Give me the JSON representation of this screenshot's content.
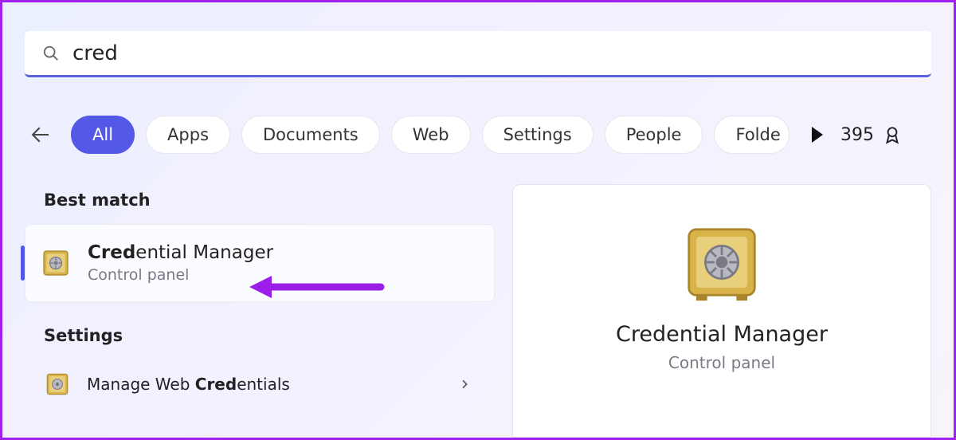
{
  "search": {
    "value": "cred"
  },
  "filters": {
    "items": [
      "All",
      "Apps",
      "Documents",
      "Web",
      "Settings",
      "People",
      "Folde"
    ],
    "active_index": 0
  },
  "rewards": {
    "points": "395"
  },
  "sections": {
    "best_match_label": "Best match",
    "settings_label": "Settings"
  },
  "best_match": {
    "title_prefix": "Cred",
    "title_rest": "ential Manager",
    "subtitle": "Control panel"
  },
  "settings_results": [
    {
      "prefix": "Manage Web ",
      "bold": "Cred",
      "rest": "entials"
    }
  ],
  "preview": {
    "title": "Credential Manager",
    "subtitle": "Control panel"
  }
}
